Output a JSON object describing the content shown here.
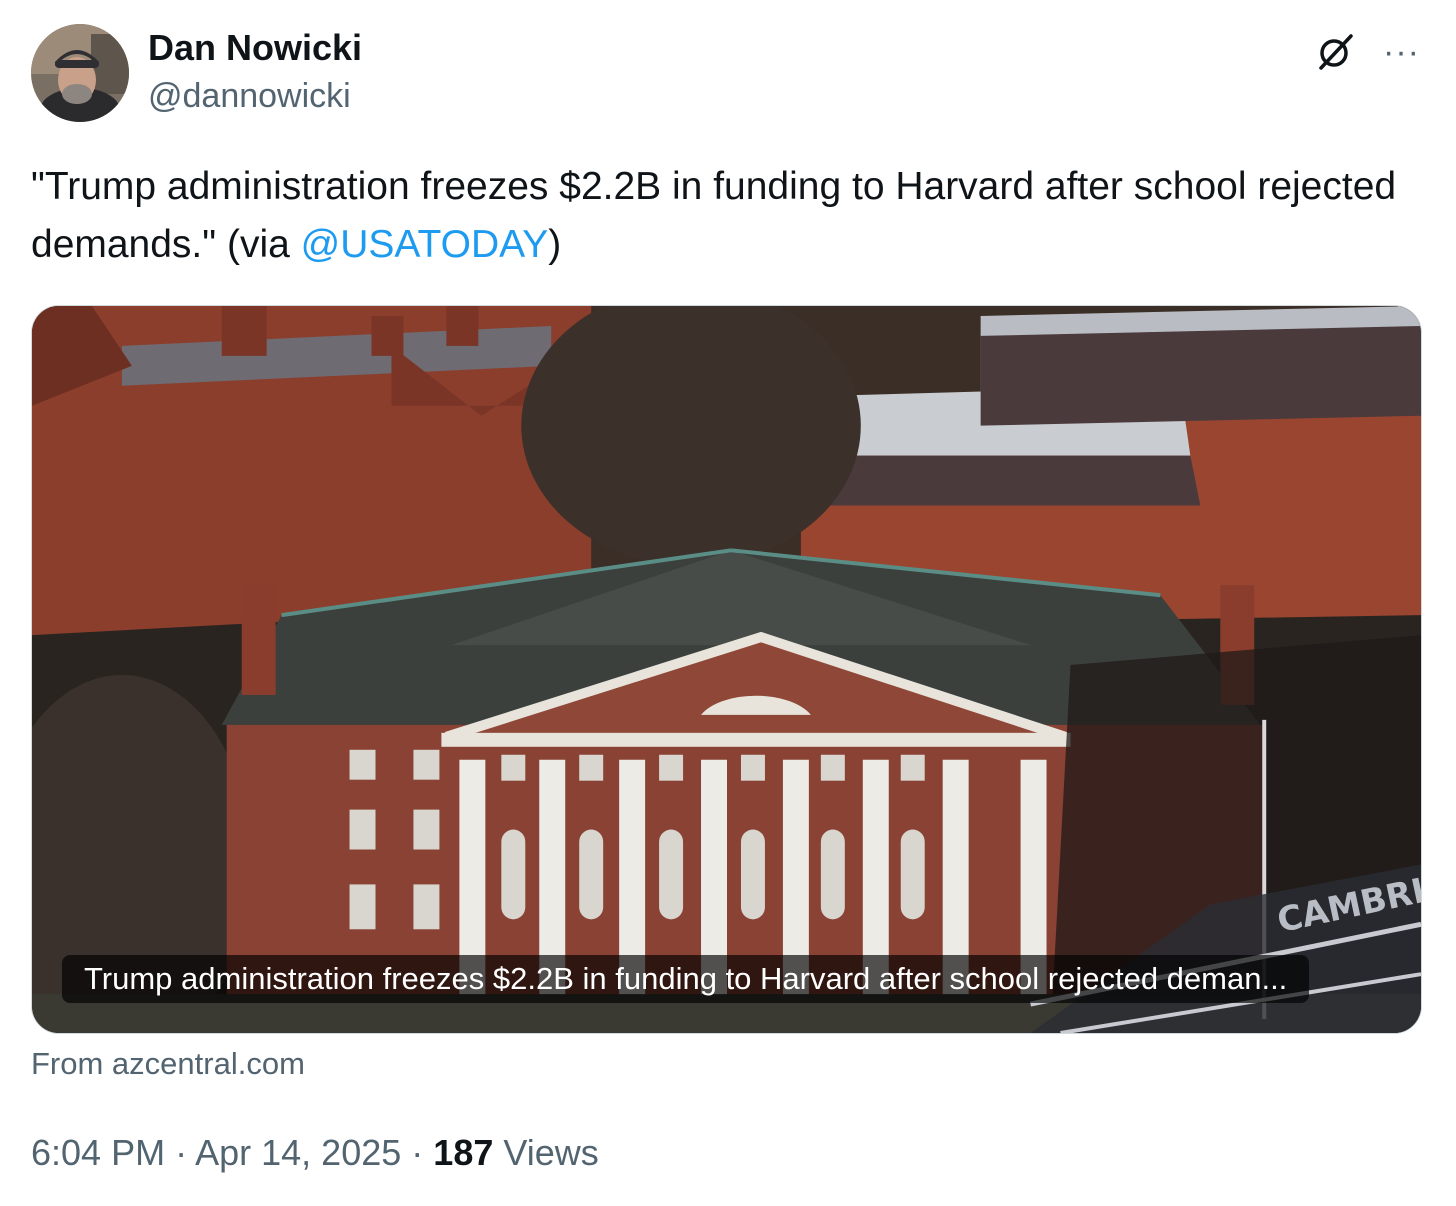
{
  "author": {
    "display_name": "Dan Nowicki",
    "handle": "@dannowicki"
  },
  "icons": {
    "grok": "grok-icon",
    "more": "more-icon",
    "more_glyph": "···"
  },
  "tweet": {
    "text_before": "\"Trump administration freezes $2.2B in funding to Harvard after school rejected demands.\" (via ",
    "mention": "@USATODAY",
    "text_after": ")"
  },
  "card": {
    "caption": "Trump administration freezes $2.2B in funding to Harvard after school rejected deman...",
    "source": "From azcentral.com",
    "banner_text": "CAMBRIDGE"
  },
  "meta": {
    "time": "6:04 PM",
    "separator": "·",
    "date": "Apr 14, 2025",
    "views_count": "187",
    "views_label": "Views"
  },
  "colors": {
    "link": "#1d9bf0",
    "text": "#0f1419",
    "secondary": "#536471",
    "border": "#cfd9de"
  }
}
